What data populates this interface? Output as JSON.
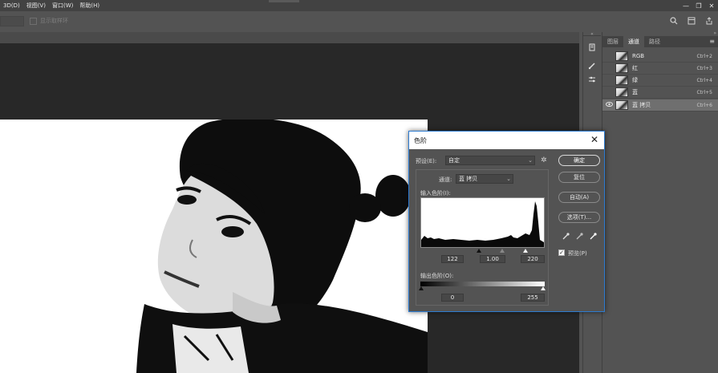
{
  "menubar": {
    "items": [
      "3D(D)",
      "视图(V)",
      "窗口(W)",
      "帮助(H)"
    ],
    "window_controls": [
      "—",
      "❐",
      "✕"
    ]
  },
  "options_bar": {
    "show_sample_ring_label": "显示取样环"
  },
  "panel": {
    "tabs": [
      "图层",
      "通道",
      "路径"
    ],
    "active_tab": "通道",
    "channels": [
      {
        "name": "RGB",
        "shortcut": "Ctrl+2",
        "visible": false,
        "selected": false
      },
      {
        "name": "红",
        "shortcut": "Ctrl+3",
        "visible": false,
        "selected": false
      },
      {
        "name": "绿",
        "shortcut": "Ctrl+4",
        "visible": false,
        "selected": false
      },
      {
        "name": "蓝",
        "shortcut": "Ctrl+5",
        "visible": false,
        "selected": false
      },
      {
        "name": "蓝 拷贝",
        "shortcut": "Ctrl+6",
        "visible": true,
        "selected": true
      }
    ]
  },
  "dialog": {
    "title": "色阶",
    "preset_label": "预设(E):",
    "preset_value": "自定",
    "channel_label": "通道:",
    "channel_value": "蓝 拷贝",
    "input_levels_label": "输入色阶(I):",
    "input_black": "122",
    "input_gamma": "1.00",
    "input_white": "220",
    "output_levels_label": "输出色阶(O):",
    "output_black": "0",
    "output_white": "255",
    "buttons": {
      "ok": "确定",
      "reset": "复位",
      "auto": "自动(A)",
      "options": "选项(T)..."
    },
    "preview_label": "预览(P)",
    "preview_checked": true
  }
}
